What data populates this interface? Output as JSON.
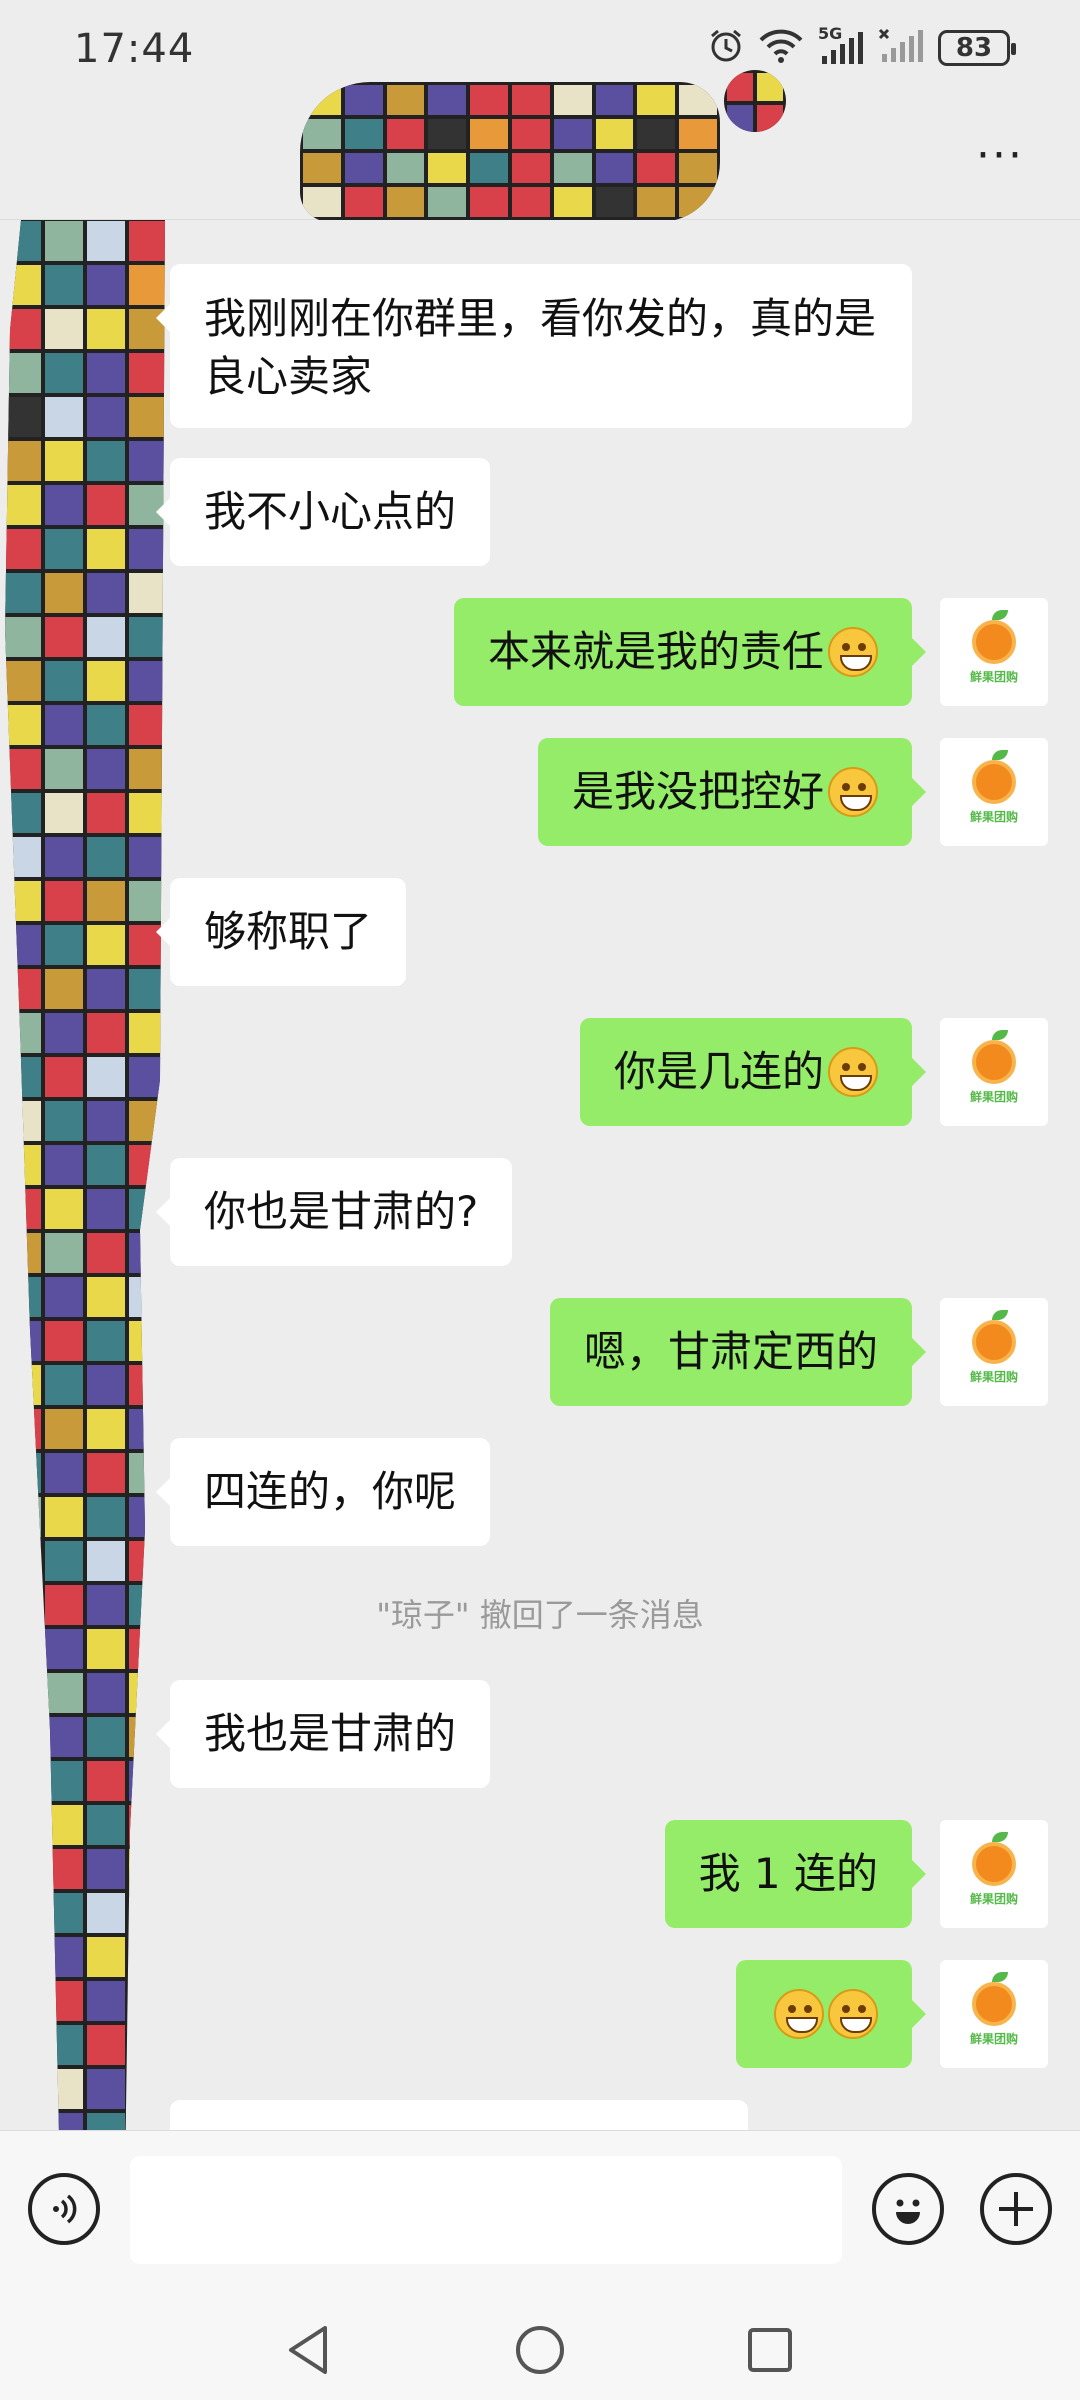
{
  "status_bar": {
    "time": "17:44",
    "network": "5G",
    "battery": "83",
    "icons": [
      "alarm-icon",
      "wifi-icon",
      "signal-icon",
      "signal-icon",
      "battery-icon"
    ]
  },
  "header": {
    "more_label": "···"
  },
  "messages": [
    {
      "side": "in",
      "text": "我刚刚在你群里，看你发的，真的是良心卖家"
    },
    {
      "side": "in",
      "text": "我不小心点的"
    },
    {
      "side": "out",
      "text": "本来就是我的责任",
      "emoji": "smile"
    },
    {
      "side": "out",
      "text": "是我没把控好",
      "emoji": "laugh-cry"
    },
    {
      "side": "in",
      "text": "够称职了"
    },
    {
      "side": "out",
      "text": "你是几连的",
      "emoji": "grin"
    },
    {
      "side": "in",
      "text": "你也是甘肃的?"
    },
    {
      "side": "out",
      "text": "嗯，甘肃定西的"
    },
    {
      "side": "in",
      "text": "四连的，你呢"
    },
    {
      "side": "system",
      "text": "\"琼子\" 撤回了一条消息"
    },
    {
      "side": "in",
      "text": "我也是甘肃的"
    },
    {
      "side": "out",
      "text": "我 1 连的"
    },
    {
      "side": "out",
      "text": "",
      "emoji": "grin grin"
    }
  ],
  "avatar": {
    "label": "鲜果团购",
    "icon": "orange-icon"
  },
  "input_bar": {
    "placeholder": "",
    "voice_icon": "voice-icon",
    "emoji_icon": "emoji-icon",
    "plus_icon": "plus-icon"
  },
  "nav_bar": {
    "icons": [
      "back-icon",
      "home-icon",
      "recents-icon"
    ]
  },
  "colors": {
    "background": "#ededed",
    "incoming_bubble": "#ffffff",
    "outgoing_bubble": "#95ec69",
    "avatar_accent": "#54b948",
    "orange": "#f28a1d"
  }
}
